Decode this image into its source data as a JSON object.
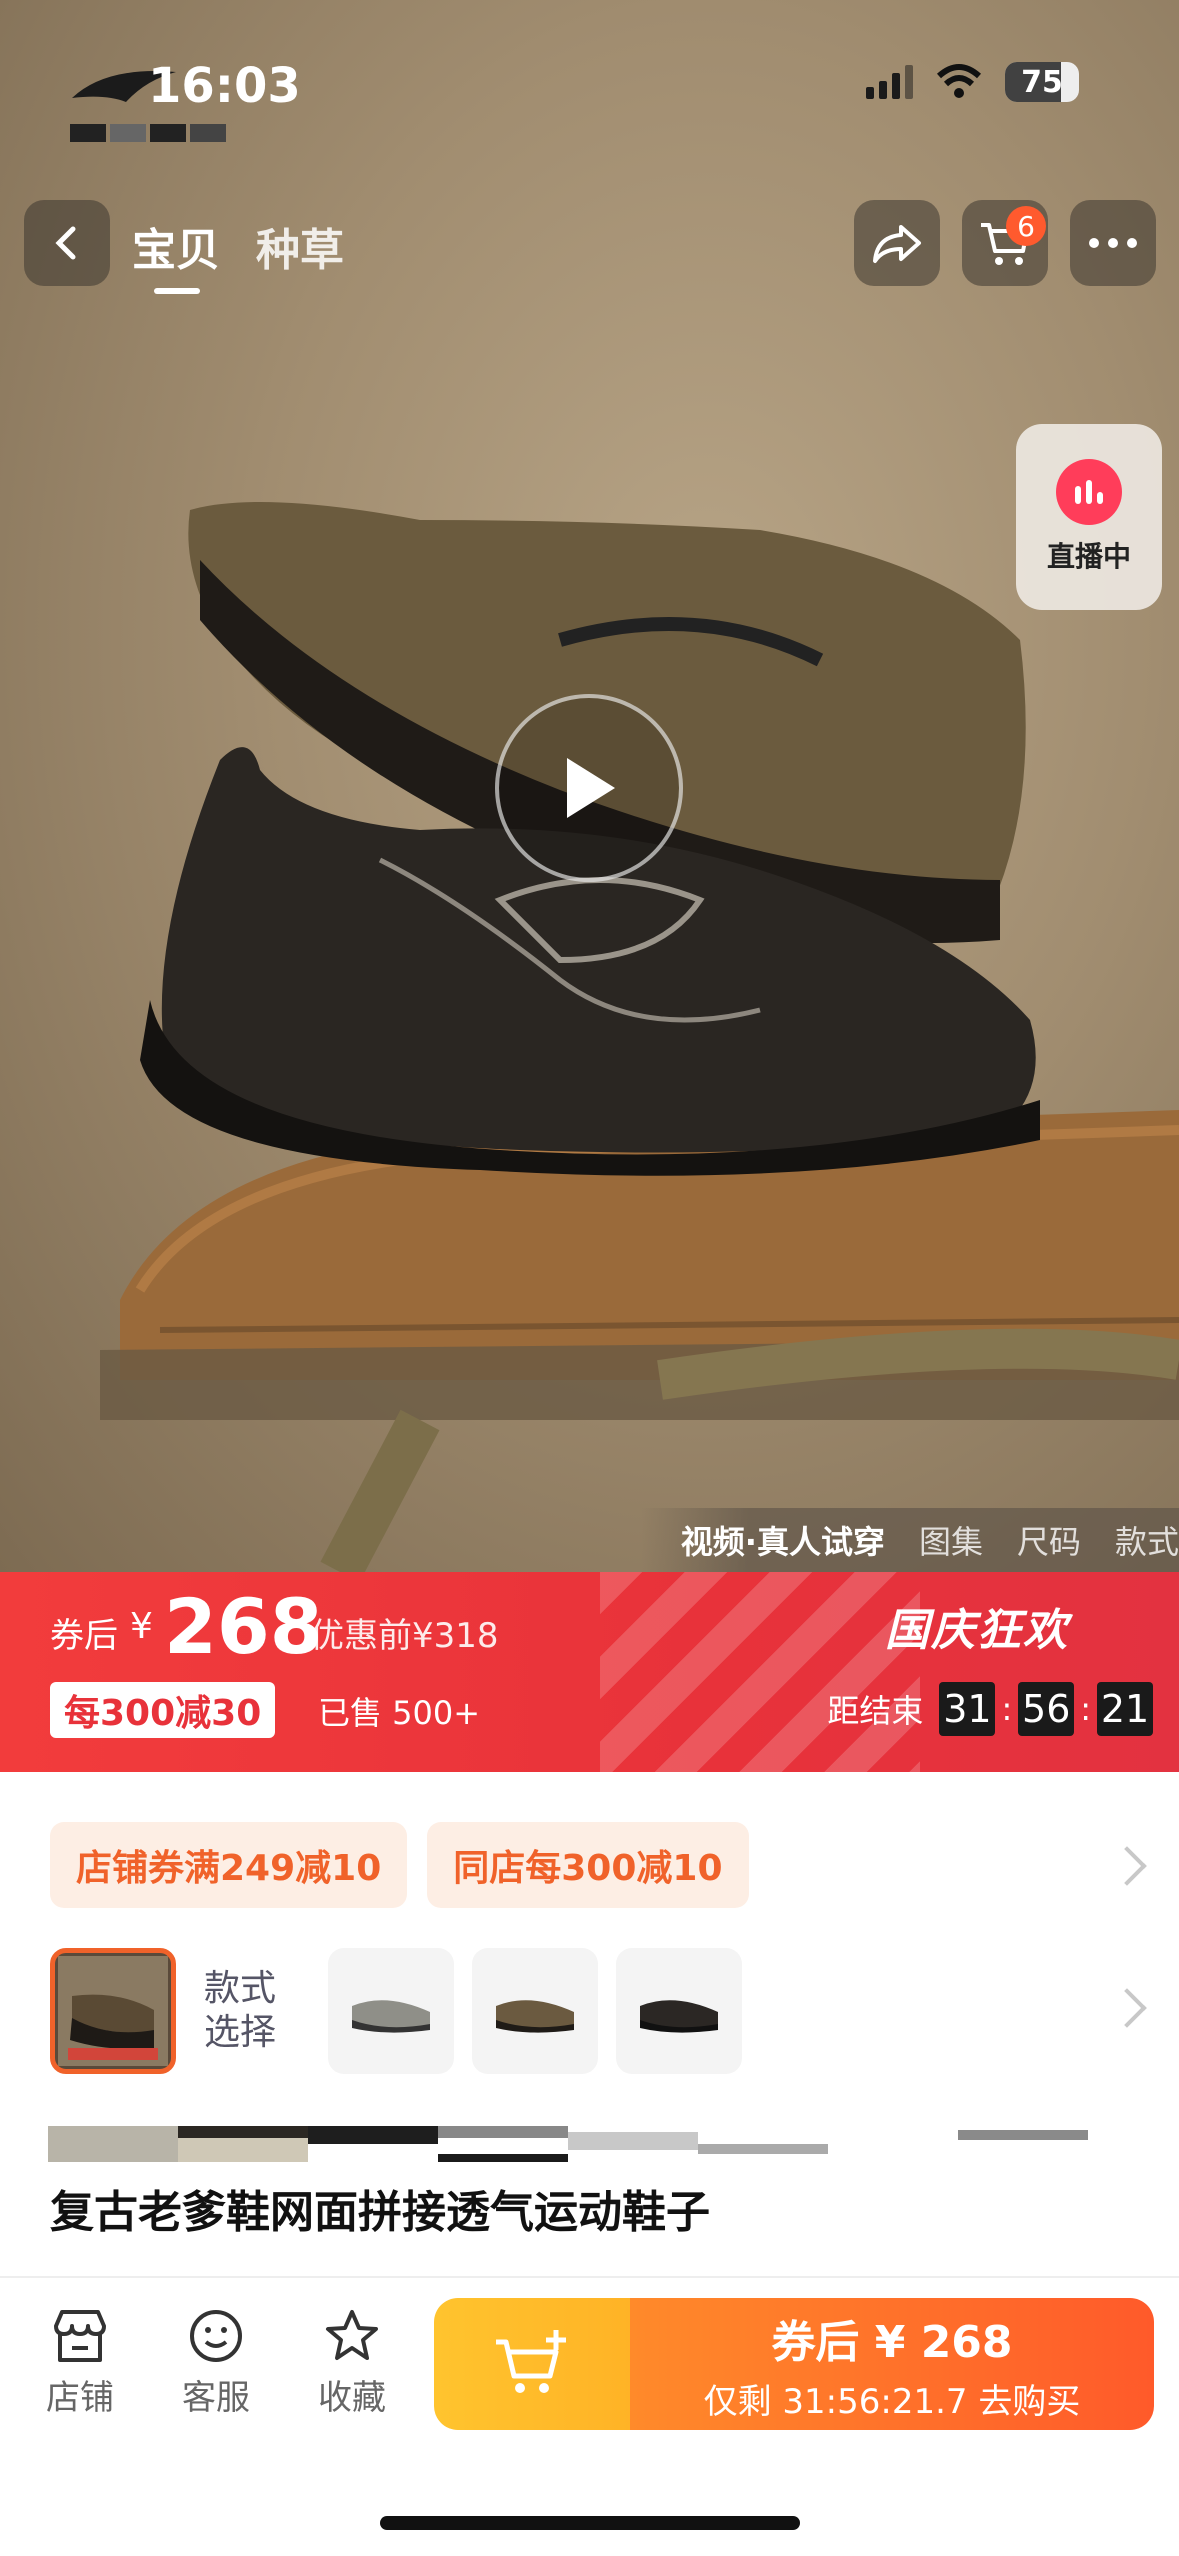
{
  "status_bar": {
    "time": "16:03",
    "battery": "75"
  },
  "top_nav": {
    "tabs": [
      {
        "label": "宝贝"
      },
      {
        "label": "种草"
      }
    ],
    "cart_count": "6"
  },
  "live": {
    "label": "直播中"
  },
  "media_tabs": [
    "视频·真人试穿",
    "图集",
    "尺码",
    "款式"
  ],
  "price_banner": {
    "after_coupon_label": "券后",
    "currency": "¥",
    "price": "268",
    "original": "优惠前¥318",
    "coupon_tag": "每300减30",
    "sold": "已售 500+",
    "event": "国庆狂欢",
    "countdown_label": "距结束",
    "countdown": {
      "h": "31",
      "m": "56",
      "s": "21"
    }
  },
  "coupons": [
    "店铺券满249减10",
    "同店每300减10"
  ],
  "variants": {
    "label": "款式选择"
  },
  "product_title": "复古老爹鞋网面拼接透气运动鞋子",
  "bottom_bar": {
    "store": "店铺",
    "service": "客服",
    "favorite": "收藏",
    "buy_line1": "券后 ¥ 268",
    "buy_line2": "仅剩 31:56:21.7 去购买"
  },
  "colors": {
    "accent_red": "#e8323a",
    "accent_orange": "#f0622a",
    "buy_yellow": "#ffc42e"
  }
}
